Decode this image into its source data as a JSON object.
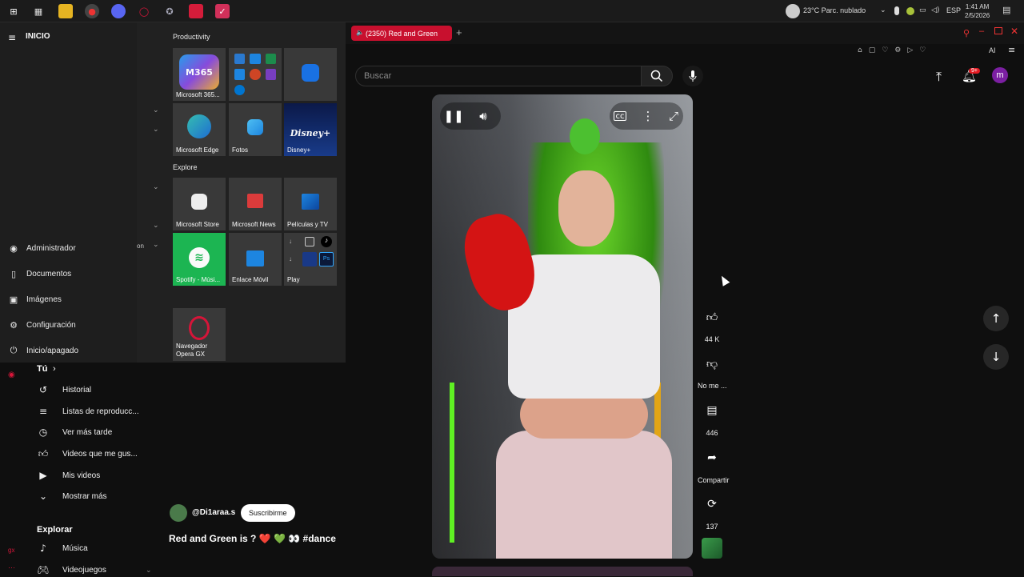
{
  "taskbar": {
    "weather": "23°C  Parc. nublado",
    "lang": "ESP",
    "time": "1:41 AM",
    "date": "2/5/2026"
  },
  "browser": {
    "tab_title": "(2350) Red and Green",
    "new_tab": "+",
    "search_placeholder": "Buscar",
    "notif_badge": "9+",
    "avatar_letter": "m",
    "ai_label": "AI"
  },
  "start_menu": {
    "title": "INICIO",
    "user": "Administrador",
    "items": [
      {
        "label": "Documentos",
        "icon": "document-icon"
      },
      {
        "label": "Imágenes",
        "icon": "image-icon"
      },
      {
        "label": "Configuración",
        "icon": "gear-icon"
      },
      {
        "label": "Inicio/apagado",
        "icon": "power-icon"
      }
    ],
    "truncated_text": "on",
    "group_productivity": "Productivity",
    "group_explore": "Explore",
    "tiles": {
      "m365": "Microsoft 365...",
      "m365_badge": "M365",
      "edge": "Microsoft Edge",
      "fotos": "Fotos",
      "disney": "Disney+",
      "disney_logo": "Disney+",
      "store": "Microsoft Store",
      "news": "Microsoft News",
      "peliculas": "Películas y TV",
      "spotify": "Spotify - Músi...",
      "enlace": "Enlace Móvil",
      "play": "Play",
      "opera": "Navegador Opera GX"
    }
  },
  "yt_sidebar": {
    "you": "Tú",
    "you_chevron": "›",
    "items": [
      {
        "label": "Historial",
        "icon": "history-icon"
      },
      {
        "label": "Listas de reproducc...",
        "icon": "playlist-icon"
      },
      {
        "label": "Ver más tarde",
        "icon": "clock-icon"
      },
      {
        "label": "Videos que me gus...",
        "icon": "thumbs-up-icon"
      },
      {
        "label": "Mis videos",
        "icon": "video-icon"
      },
      {
        "label": "Mostrar más",
        "icon": "chevron-down-icon"
      }
    ],
    "explore_title": "Explorar",
    "explore_items": [
      {
        "label": "Música",
        "icon": "music-icon"
      },
      {
        "label": "Videojuegos",
        "icon": "gamepad-icon"
      }
    ]
  },
  "video": {
    "channel": "@Di1araa.s",
    "subscribe": "Suscribirme",
    "title": "Red and Green is ? ❤️ 💚 👀 #dance"
  },
  "actions": {
    "likes": "44 K",
    "dislike": "No me ...",
    "comments": "446",
    "share": "Compartir",
    "remix": "137"
  }
}
